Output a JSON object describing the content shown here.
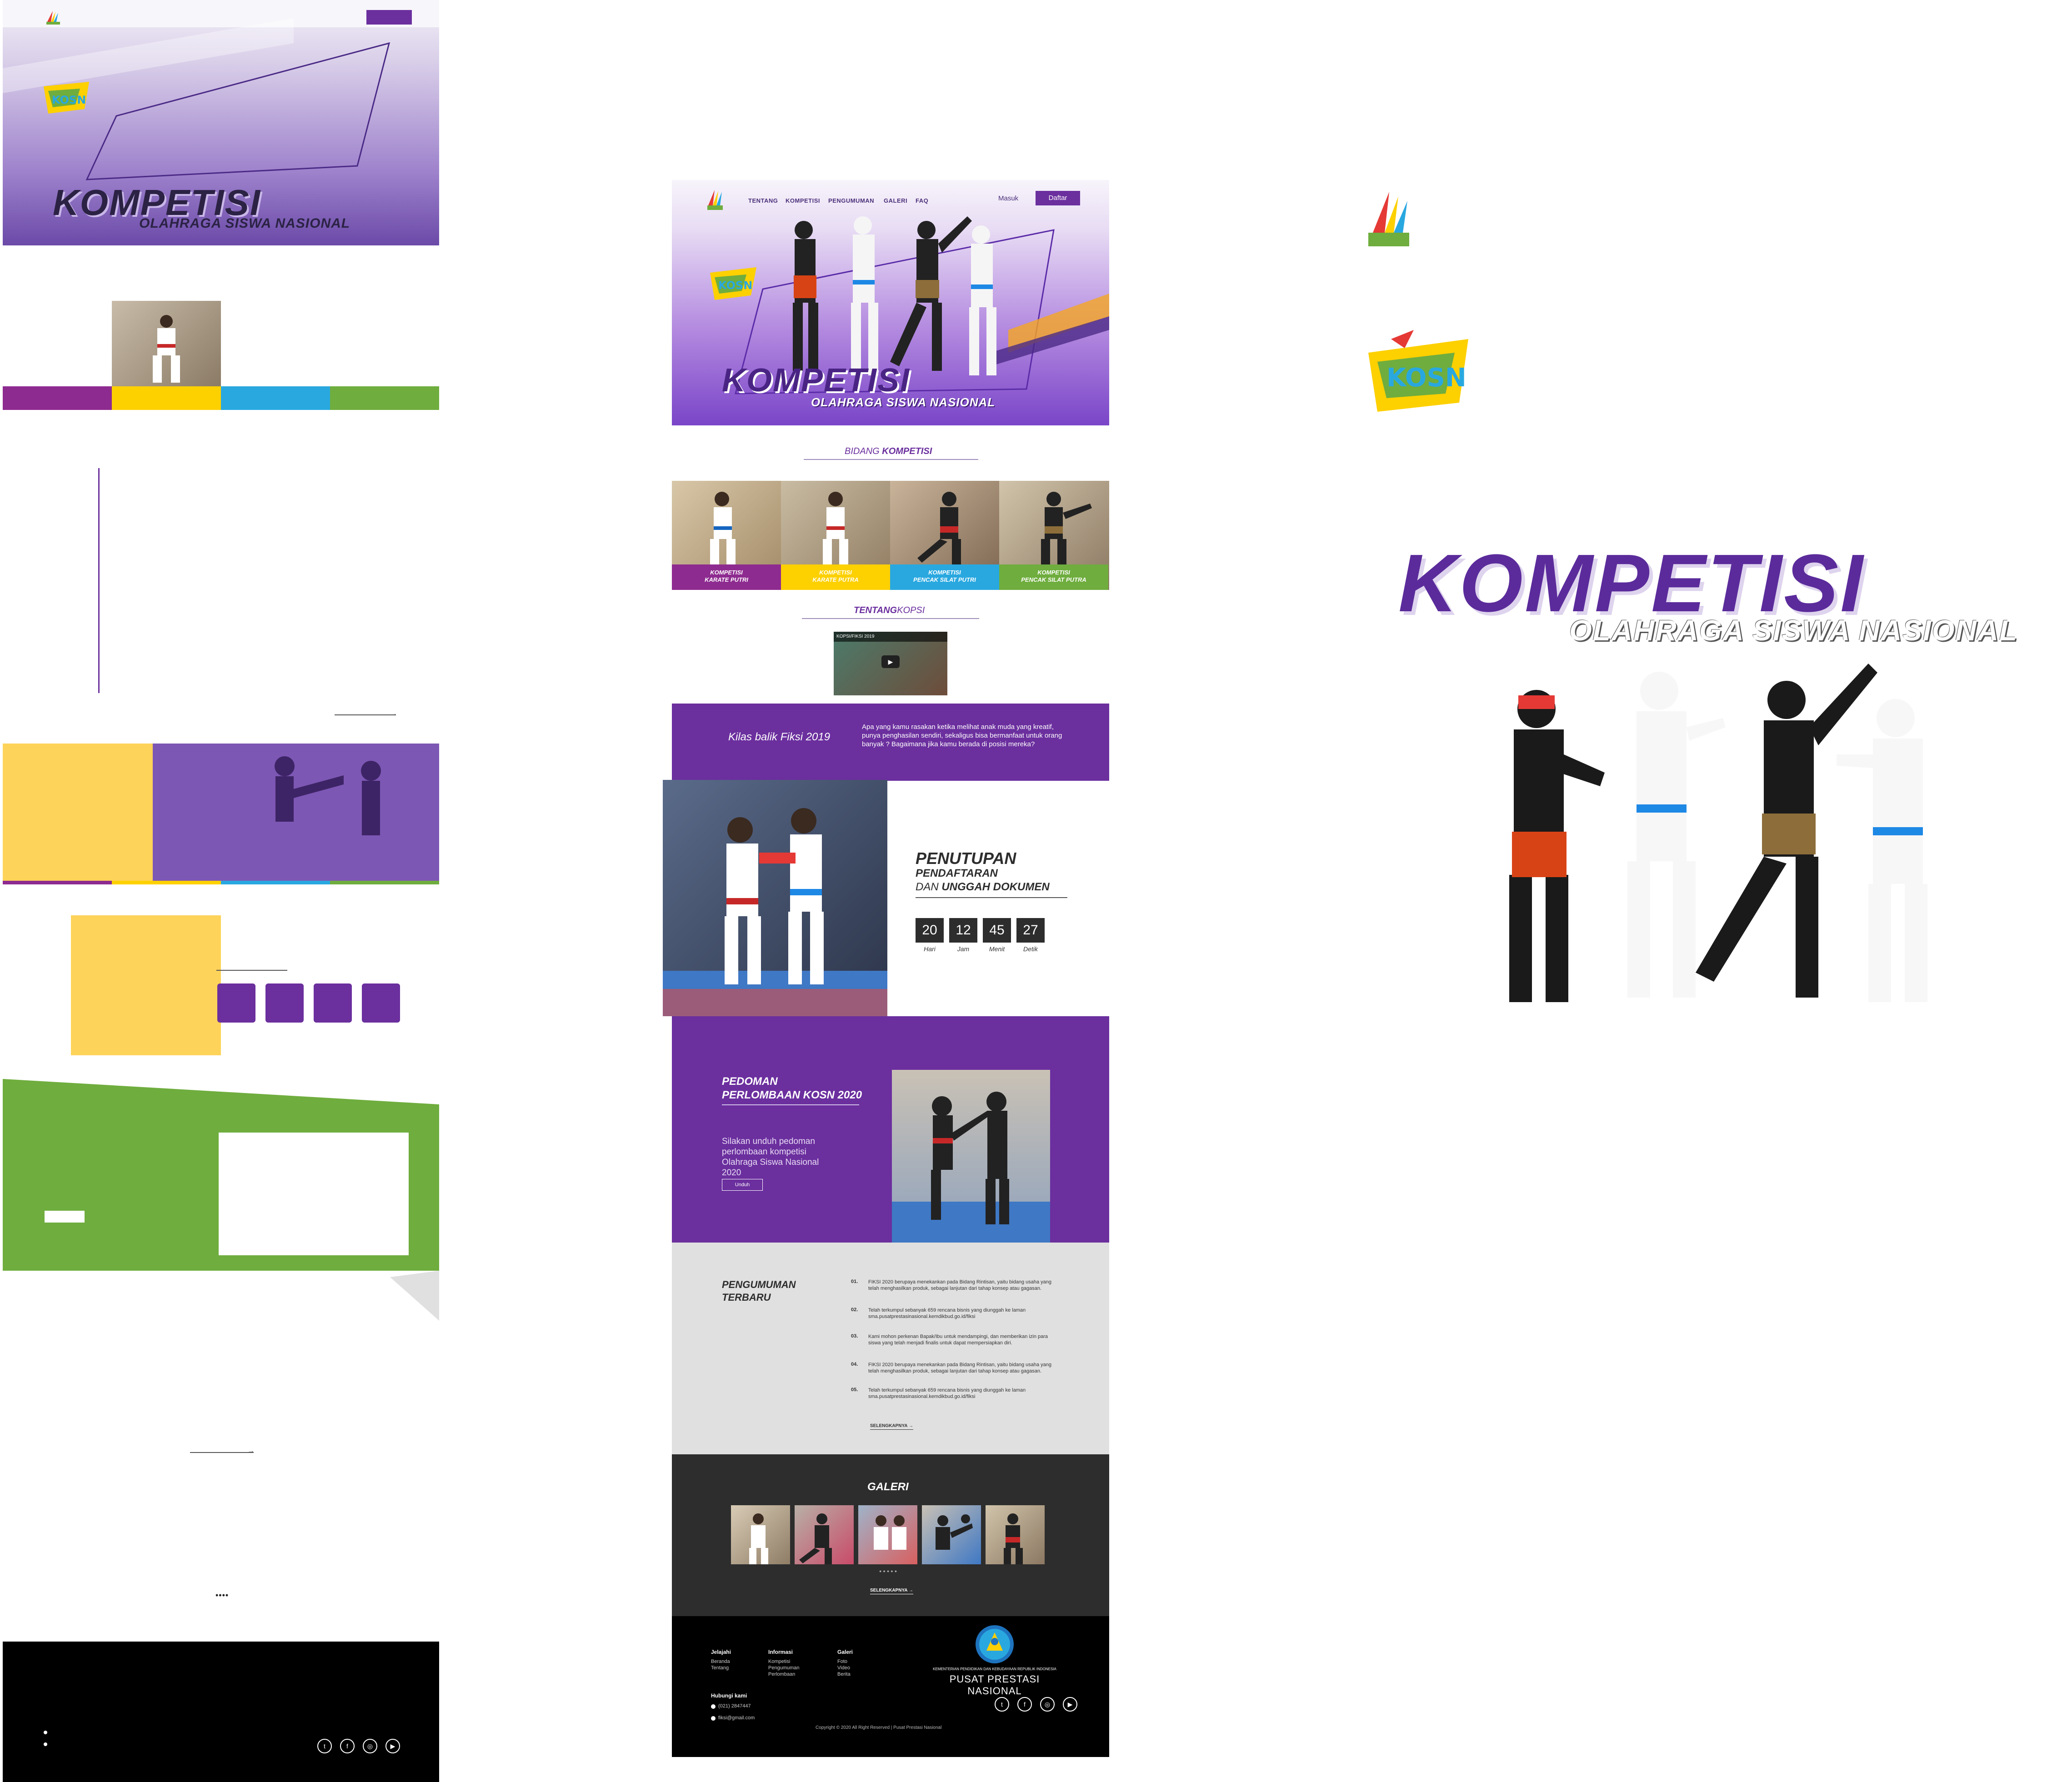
{
  "colors": {
    "purple": "#6b2f9e",
    "yellow": "#fdd000",
    "blue": "#29a8e0",
    "green": "#6fad3e",
    "dark": "#2d2d2d",
    "black": "#000000"
  },
  "nav": {
    "links": [
      "TENTANG",
      "KOMPETISI",
      "PENGUMUMAN",
      "GALERI",
      "FAQ"
    ],
    "login": "Masuk",
    "register": "Daftar"
  },
  "hero": {
    "title": "KOMPETISI",
    "subtitle": "OLAHRAGA SISWA NASIONAL"
  },
  "bidang": {
    "heading_light": "BIDANG",
    "heading_bold": "KOMPETISI",
    "tiles": [
      {
        "line1": "KOMPETISI",
        "line2": "KARATE PUTRI"
      },
      {
        "line1": "KOMPETISI",
        "line2": "KARATE PUTRA"
      },
      {
        "line1": "KOMPETISI",
        "line2": "PENCAK SILAT PUTRI"
      },
      {
        "line1": "KOMPETISI",
        "line2": "PENCAK SILAT PUTRA"
      }
    ]
  },
  "tentang": {
    "heading_bold": "TENTANG",
    "heading_light": "KOPSI",
    "video_title": "KOPSI/FIKSI 2019"
  },
  "kilas": {
    "title": "Kilas balik Fiksi 2019",
    "text": "Apa yang kamu rasakan ketika melihat anak muda yang kreatif, punya  penghasilan sendiri, sekaligus bisa bermanfaat untuk orang banyak ? Bagaimana jika kamu berada di posisi mereka?"
  },
  "countdown": {
    "title": "PENUTUPAN",
    "line2": "PENDAFTARAN",
    "line3_light": "DAN",
    "line3_bold": "UNGGAH DOKUMEN",
    "values": [
      "20",
      "12",
      "45",
      "27"
    ],
    "labels": [
      "Hari",
      "Jam",
      "Menit",
      "Detik"
    ]
  },
  "pedoman": {
    "title1": "PEDOMAN",
    "title2": "PERLOMBAAN KOSN 2020",
    "text": "Silakan unduh pedoman perlombaan kompetisi Olahraga Siswa Nasional 2020",
    "button": "Unduh"
  },
  "pengumuman": {
    "title1": "PENGUMUMAN",
    "title2": "TERBARU",
    "items": [
      {
        "num": "01.",
        "text": "FIKSI 2020 berupaya menekankan pada Bidang Rintisan, yaitu bidang usaha yang telah menghasilkan produk, sebagai lanjutan dari tahap konsep atau gagasan."
      },
      {
        "num": "02.",
        "text": "Telah terkumpul sebanyak 659 rencana bisnis yang diunggah ke laman sma.pusatprestasinasional.kemdikbud.go.id/fiksi"
      },
      {
        "num": "03.",
        "text": "Kami mohon perkenan Bapak/Ibu untuk mendampingi, dan memberikan izin para siswa yang telah menjadi finalis untuk dapat mempersiapkan diri."
      },
      {
        "num": "04.",
        "text": "FIKSI 2020 berupaya menekankan pada Bidang Rintisan, yaitu bidang usaha yang telah menghasilkan produk, sebagai lanjutan dari tahap konsep atau gagasan."
      },
      {
        "num": "05.",
        "text": "Telah terkumpul sebanyak 659 rencana bisnis yang diunggah ke laman sma.pusatprestasinasional.kemdikbud.go.id/fiksi"
      }
    ],
    "more": "SELENGKAPNYA →"
  },
  "galeri": {
    "title": "GALERI",
    "more": "SELENGKAPNYA →"
  },
  "footer": {
    "col1_head": "Jelajahi",
    "col1": [
      "Beranda",
      "Tentang"
    ],
    "col2_head": "Informasi",
    "col2": [
      "Kompetisi",
      "Pengumuman",
      "Perlombaan"
    ],
    "col3_head": "Galeri",
    "col3": [
      "Foto",
      "Video",
      "Berita"
    ],
    "contact_head": "Hubungi kami",
    "phone": "(021) 2847447",
    "email": "fiksi@gmail.com",
    "ministry": "KEMENTERIAN PENDIDIKAN DAN KEBUDAYAAN REPUBLIK INDONESIA",
    "org": "PUSAT PRESTASI NASIONAL",
    "copyright": "Copyright © 2020 All Right Reserved | Pusat Prestasi Nasional"
  },
  "big": {
    "title": "KOMPETISI",
    "subtitle": "OLAHRAGA SISWA NASIONAL"
  },
  "logo_text": "KOSN"
}
